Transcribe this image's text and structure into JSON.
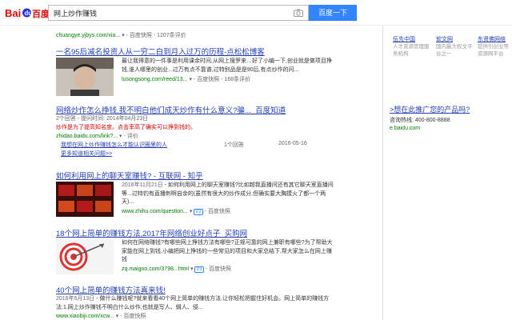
{
  "search": {
    "query": "网上炒作赚钱",
    "button_label": "百度一下"
  },
  "results": [
    {
      "url": "chuangye.yjbys.com/xia...",
      "snapshot": "百度快照",
      "reviews": "1207条评价"
    },
    {
      "title": "一名95后减名投资人从一穷二白到月入过万的历程-点松松博客",
      "abstract": "最让我得意的一件事是利用课余时间,从网上搜罗来…好了小编一下,创业就是做项目挣钱,谁人哪里的创业...过万有点不靠谱,过特别品是是90后,有点炒作的问...",
      "url": "lusongsong.com/reed/13...",
      "snapshot": "百度快照",
      "reviews": "168条评价"
    },
    {
      "title": "网络炒作怎么挣钱,我不明白他们成天炒作有什么意义?骗..._百度知道",
      "meta": "2个回答 - 提问时间: 2014年04月23日",
      "abstract": "炒作是为了提高知名度。点击率高了确实可以挣到钱的。",
      "url": "zhidao.baidu.com/link?...",
      "evaluate": "评价",
      "sub_q": "我想在网上炒作赚钱怎么才能认识圈里的人",
      "sub_answers": "1个回答",
      "sub_date": "2016-05-16",
      "more": "更多知道相关问题>>"
    },
    {
      "title": "如何利用网上的聊天室赚钱? - 互联网 - 知乎",
      "date": "2016年11月21日",
      "abstract": " - 如何利用网上的聊天室赚钱?比如越我直播间还有其它聊天室直播间等...过特钓有直播刺啊自余的(虽然有很大的炒作成分,但确实要大胸摸火了都一个两天)...",
      "url": "www.zhihu.com/question...",
      "v": "V2",
      "snapshot": "百度快照"
    },
    {
      "title": "18个网上简单的赚钱方法,2017年网络创业好点子_买购网",
      "abstract": "如何在网络赚钱?有哪些网上挣钱方法有哪些?正规可靠的网上兼职有哪些?为了帮助大家能在网上到钱,小编把网上挣钱的一些常见的项目和大家总结下,帮大家怎么在网上赚钱",
      "url": "zq.maigoo.com/3798...html",
      "v": "V1",
      "snapshot": "百度快照"
    },
    {
      "title": "40个网上简单的赚钱方法真来钱!",
      "date": "2016年5月13日",
      "abstract": " - 做什么赚钱呢?就来看看40个网上简单的赚钱方法,让你轻松把握住好机会。网上简单的赚钱方法:1.网上炒作赚钱不明白什么炒作,也就是写人、辑人、侵...",
      "url": "www.xiaobiji.com/xcw...",
      "snapshot": "百度快照"
    }
  ],
  "sidebar": {
    "items": [
      {
        "title": "伍先中国",
        "desc": "人才资源管理服务机构"
      },
      {
        "title": "软文网",
        "desc": "国内最大权文平台之一"
      },
      {
        "title": "东贤佛网络",
        "desc": "提供引创业等资源网平台"
      }
    ],
    "promo_link": ">想在此推广您的产品吗?",
    "hotline": "咨询热线: 400-800-8888",
    "promo_url": "e.baidu.com"
  },
  "colors": {
    "link": "#2440b3",
    "highlight": "#c00000",
    "url": "#008000",
    "button": "#3385ff"
  }
}
